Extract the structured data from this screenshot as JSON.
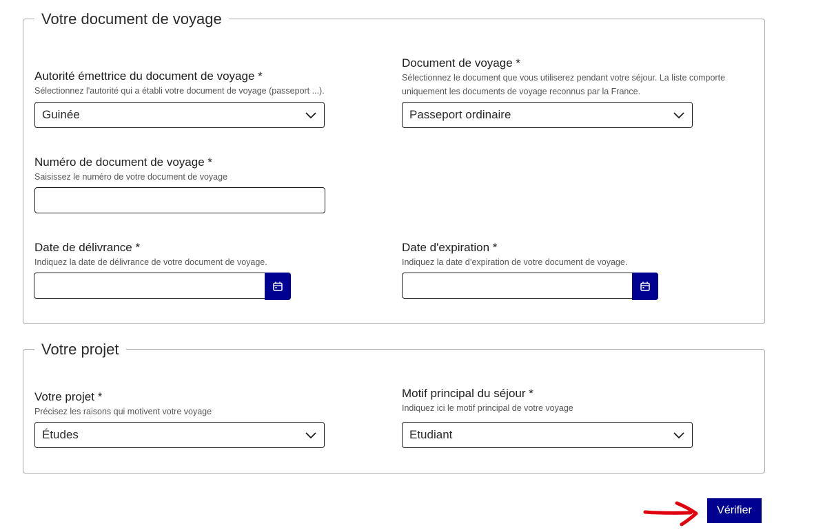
{
  "travel_doc": {
    "legend": "Votre document de voyage",
    "issuer": {
      "label": "Autorité émettrice du document de voyage",
      "hint": "Sélectionnez l'autorité qui a établi votre document de voyage (passeport ...).",
      "value": "Guinée"
    },
    "doc_type": {
      "label": "Document de voyage",
      "hint_line1": "Sélectionnez le document que vous utiliserez pendant votre séjour. La liste comporte",
      "hint_line2": "uniquement les documents de voyage reconnus par la France.",
      "value": "Passeport ordinaire"
    },
    "doc_number": {
      "label": "Numéro de document de voyage",
      "hint": "Saisissez le numéro de votre document de voyage",
      "value": ""
    },
    "issue_date": {
      "label": "Date de délivrance",
      "hint": "Indiquez la date de délivrance de votre document de voyage.",
      "value": ""
    },
    "expiry_date": {
      "label": "Date d'expiration",
      "hint": "Indiquez la date d’expiration de votre document de voyage.",
      "value": ""
    }
  },
  "project": {
    "legend": "Votre projet",
    "project": {
      "label": "Votre projet",
      "hint": "Précisez les raisons qui motivent votre voyage",
      "value": "Études"
    },
    "reason": {
      "label": "Motif principal du séjour",
      "hint": "Indiquez ici le motif principal de votre voyage",
      "value": "Etudiant"
    }
  },
  "required_mark": "*",
  "verify_button": "Vérifier",
  "icons": {
    "select": "chevron-down-icon",
    "date": "calendar-icon",
    "annotation": "red-arrow-icon"
  },
  "colors": {
    "primary": "#000091",
    "border": "#1e1e1e",
    "fieldset_border": "#a8a8a8",
    "annotation": "#e1000f"
  }
}
